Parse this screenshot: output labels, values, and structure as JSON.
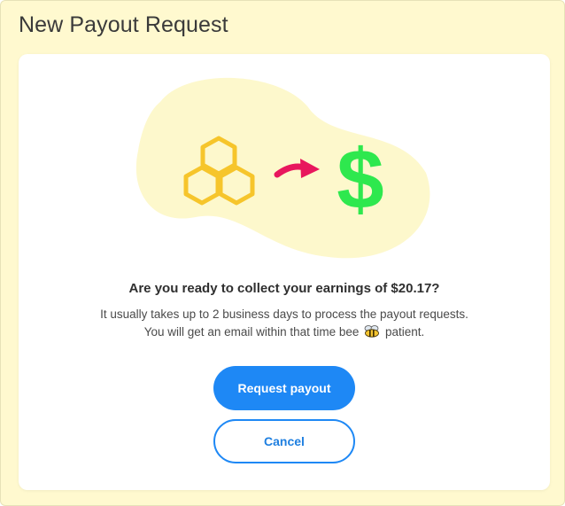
{
  "modal": {
    "title": "New Payout Request",
    "question": "Are you ready to collect your earnings of $20.17?",
    "info_before": "It usually takes up to 2 business days to process the payout requests. You will get an email within that time bee",
    "info_after": "patient.",
    "bee_icon": "bee-icon",
    "illustration": {
      "honeycomb_icon": "honeycomb-icon",
      "arrow_icon": "arrow-right-icon",
      "dollar_icon": "dollar-icon",
      "dollar_symbol": "$",
      "colors": {
        "blob": "#fdf8cc",
        "honeycomb": "#f6c52b",
        "arrow": "#e8175d",
        "dollar": "#2ee84e"
      }
    }
  },
  "buttons": {
    "request_label": "Request payout",
    "cancel_label": "Cancel"
  },
  "colors": {
    "accent": "#1e88f5",
    "frame_background": "#fff9cf",
    "card_background": "#ffffff"
  }
}
